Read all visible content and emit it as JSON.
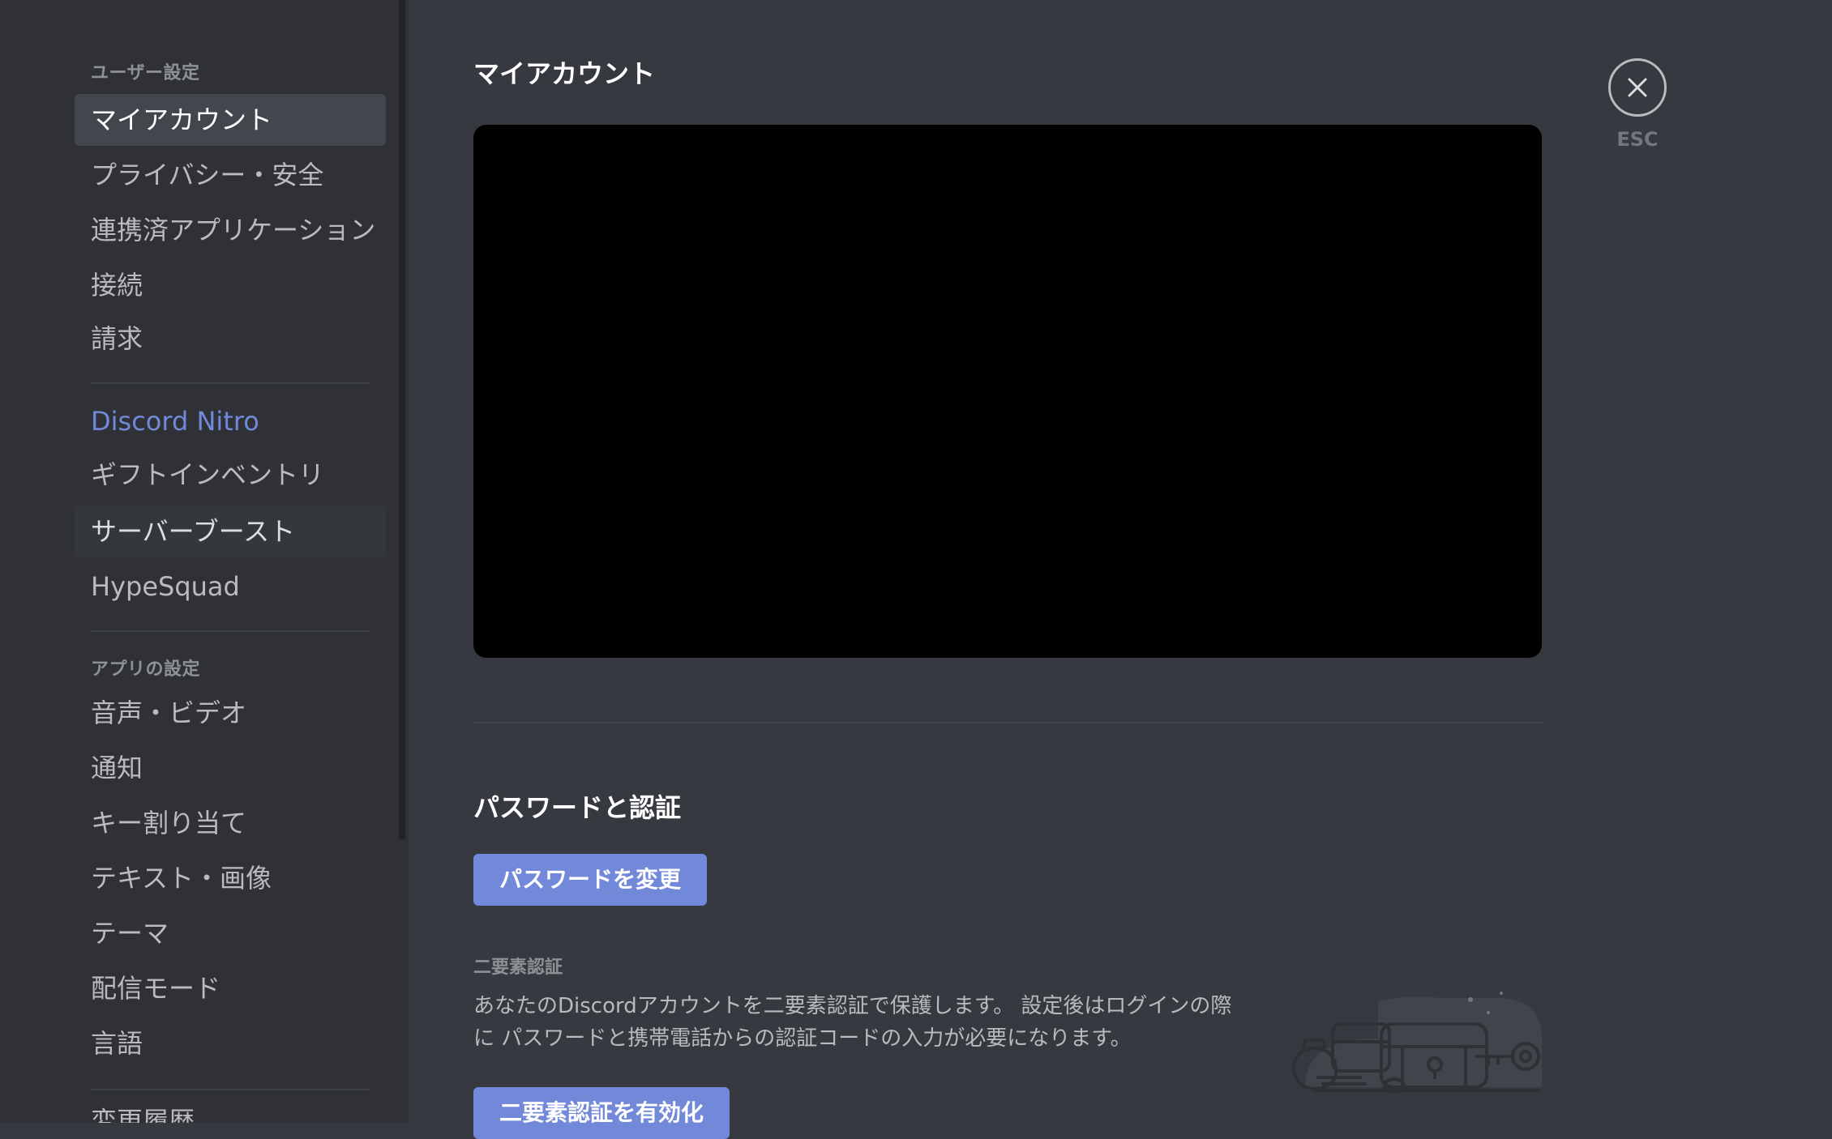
{
  "sidebar": {
    "user_settings_header": "ユーザー設定",
    "user_items": [
      {
        "label": "マイアカウント"
      },
      {
        "label": "プライバシー・安全"
      },
      {
        "label": "連携済アプリケーション"
      },
      {
        "label": "接続"
      },
      {
        "label": "請求"
      }
    ],
    "nitro_items": [
      {
        "label": "Discord Nitro"
      },
      {
        "label": "ギフトインベントリ"
      },
      {
        "label": "サーバーブースト"
      },
      {
        "label": "HypeSquad"
      }
    ],
    "app_settings_header": "アプリの設定",
    "app_items": [
      {
        "label": "音声・ビデオ"
      },
      {
        "label": "通知"
      },
      {
        "label": "キー割り当て"
      },
      {
        "label": "テキスト・画像"
      },
      {
        "label": "テーマ"
      },
      {
        "label": "配信モード"
      },
      {
        "label": "言語"
      }
    ],
    "partial_item": "変更履歴"
  },
  "main": {
    "title": "マイアカウント",
    "password_section": {
      "title": "パスワードと認証",
      "change_password_button": "パスワードを変更"
    },
    "mfa": {
      "label": "二要素認証",
      "description": "あなたのDiscordアカウントを二要素認証で保護します。 設定後はログインの際に パスワードと携帯電話からの認証コードの入力が必要になります。",
      "enable_button": "二要素認証を有効化"
    }
  },
  "close": {
    "label": "ESC"
  },
  "colors": {
    "accent": "#7289da",
    "background": "#36393f",
    "sidebar": "#2f3136"
  },
  "icons": {
    "close": "close-icon",
    "illustration": "treasure-chest-key-illustration"
  }
}
